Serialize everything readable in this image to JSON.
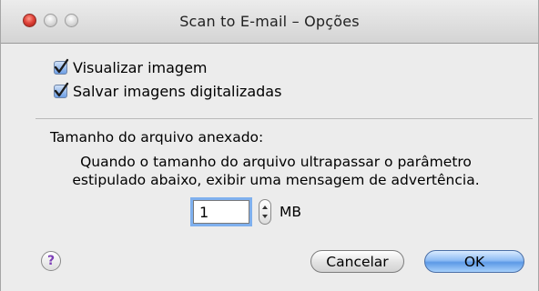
{
  "window": {
    "title": "Scan to E-mail – Opções"
  },
  "options": {
    "preview_label": "Visualizar imagem",
    "preview_checked": true,
    "save_label": "Salvar imagens digitalizadas",
    "save_checked": true
  },
  "attachment": {
    "section_title": "Tamanho do arquivo anexado:",
    "description_line1": "Quando o tamanho do arquivo ultrapassar o parâmetro",
    "description_line2": "estipulado abaixo, exibir uma mensagem de advertência.",
    "size_value": "1",
    "unit": "MB"
  },
  "footer": {
    "help_label": "?",
    "cancel_label": "Cancelar",
    "ok_label": "OK"
  },
  "icons": [
    "close-button-icon",
    "minimize-button-icon",
    "zoom-button-icon",
    "checkmark-icon",
    "stepper-arrows-icon",
    "help-icon"
  ],
  "colors": {
    "accent": "#5d99e6",
    "close_red": "#e0443b",
    "help_purple": "#7d3fb7"
  }
}
